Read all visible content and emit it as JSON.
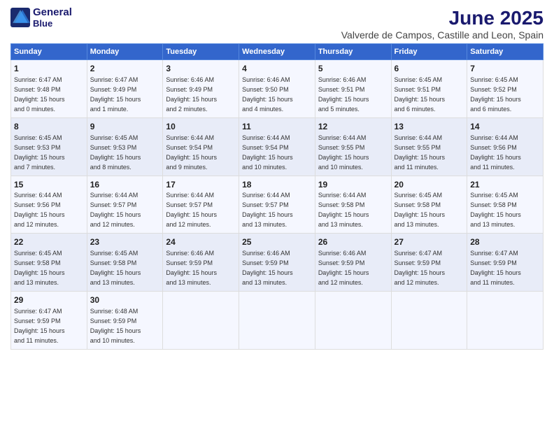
{
  "logo": {
    "line1": "General",
    "line2": "Blue"
  },
  "title": "June 2025",
  "subtitle": "Valverde de Campos, Castille and Leon, Spain",
  "weekdays": [
    "Sunday",
    "Monday",
    "Tuesday",
    "Wednesday",
    "Thursday",
    "Friday",
    "Saturday"
  ],
  "weeks": [
    [
      {
        "day": "1",
        "sunrise": "6:47 AM",
        "sunset": "9:48 PM",
        "daylight": "15 hours and 0 minutes."
      },
      {
        "day": "2",
        "sunrise": "6:47 AM",
        "sunset": "9:49 PM",
        "daylight": "15 hours and 1 minute."
      },
      {
        "day": "3",
        "sunrise": "6:46 AM",
        "sunset": "9:49 PM",
        "daylight": "15 hours and 2 minutes."
      },
      {
        "day": "4",
        "sunrise": "6:46 AM",
        "sunset": "9:50 PM",
        "daylight": "15 hours and 4 minutes."
      },
      {
        "day": "5",
        "sunrise": "6:46 AM",
        "sunset": "9:51 PM",
        "daylight": "15 hours and 5 minutes."
      },
      {
        "day": "6",
        "sunrise": "6:45 AM",
        "sunset": "9:51 PM",
        "daylight": "15 hours and 6 minutes."
      },
      {
        "day": "7",
        "sunrise": "6:45 AM",
        "sunset": "9:52 PM",
        "daylight": "15 hours and 6 minutes."
      }
    ],
    [
      {
        "day": "8",
        "sunrise": "6:45 AM",
        "sunset": "9:53 PM",
        "daylight": "15 hours and 7 minutes."
      },
      {
        "day": "9",
        "sunrise": "6:45 AM",
        "sunset": "9:53 PM",
        "daylight": "15 hours and 8 minutes."
      },
      {
        "day": "10",
        "sunrise": "6:44 AM",
        "sunset": "9:54 PM",
        "daylight": "15 hours and 9 minutes."
      },
      {
        "day": "11",
        "sunrise": "6:44 AM",
        "sunset": "9:54 PM",
        "daylight": "15 hours and 10 minutes."
      },
      {
        "day": "12",
        "sunrise": "6:44 AM",
        "sunset": "9:55 PM",
        "daylight": "15 hours and 10 minutes."
      },
      {
        "day": "13",
        "sunrise": "6:44 AM",
        "sunset": "9:55 PM",
        "daylight": "15 hours and 11 minutes."
      },
      {
        "day": "14",
        "sunrise": "6:44 AM",
        "sunset": "9:56 PM",
        "daylight": "15 hours and 11 minutes."
      }
    ],
    [
      {
        "day": "15",
        "sunrise": "6:44 AM",
        "sunset": "9:56 PM",
        "daylight": "15 hours and 12 minutes."
      },
      {
        "day": "16",
        "sunrise": "6:44 AM",
        "sunset": "9:57 PM",
        "daylight": "15 hours and 12 minutes."
      },
      {
        "day": "17",
        "sunrise": "6:44 AM",
        "sunset": "9:57 PM",
        "daylight": "15 hours and 12 minutes."
      },
      {
        "day": "18",
        "sunrise": "6:44 AM",
        "sunset": "9:57 PM",
        "daylight": "15 hours and 13 minutes."
      },
      {
        "day": "19",
        "sunrise": "6:44 AM",
        "sunset": "9:58 PM",
        "daylight": "15 hours and 13 minutes."
      },
      {
        "day": "20",
        "sunrise": "6:45 AM",
        "sunset": "9:58 PM",
        "daylight": "15 hours and 13 minutes."
      },
      {
        "day": "21",
        "sunrise": "6:45 AM",
        "sunset": "9:58 PM",
        "daylight": "15 hours and 13 minutes."
      }
    ],
    [
      {
        "day": "22",
        "sunrise": "6:45 AM",
        "sunset": "9:58 PM",
        "daylight": "15 hours and 13 minutes."
      },
      {
        "day": "23",
        "sunrise": "6:45 AM",
        "sunset": "9:58 PM",
        "daylight": "15 hours and 13 minutes."
      },
      {
        "day": "24",
        "sunrise": "6:46 AM",
        "sunset": "9:59 PM",
        "daylight": "15 hours and 13 minutes."
      },
      {
        "day": "25",
        "sunrise": "6:46 AM",
        "sunset": "9:59 PM",
        "daylight": "15 hours and 13 minutes."
      },
      {
        "day": "26",
        "sunrise": "6:46 AM",
        "sunset": "9:59 PM",
        "daylight": "15 hours and 12 minutes."
      },
      {
        "day": "27",
        "sunrise": "6:47 AM",
        "sunset": "9:59 PM",
        "daylight": "15 hours and 12 minutes."
      },
      {
        "day": "28",
        "sunrise": "6:47 AM",
        "sunset": "9:59 PM",
        "daylight": "15 hours and 11 minutes."
      }
    ],
    [
      {
        "day": "29",
        "sunrise": "6:47 AM",
        "sunset": "9:59 PM",
        "daylight": "15 hours and 11 minutes."
      },
      {
        "day": "30",
        "sunrise": "6:48 AM",
        "sunset": "9:59 PM",
        "daylight": "15 hours and 10 minutes."
      },
      null,
      null,
      null,
      null,
      null
    ]
  ],
  "labels": {
    "sunrise": "Sunrise:",
    "sunset": "Sunset:",
    "daylight": "Daylight:"
  }
}
